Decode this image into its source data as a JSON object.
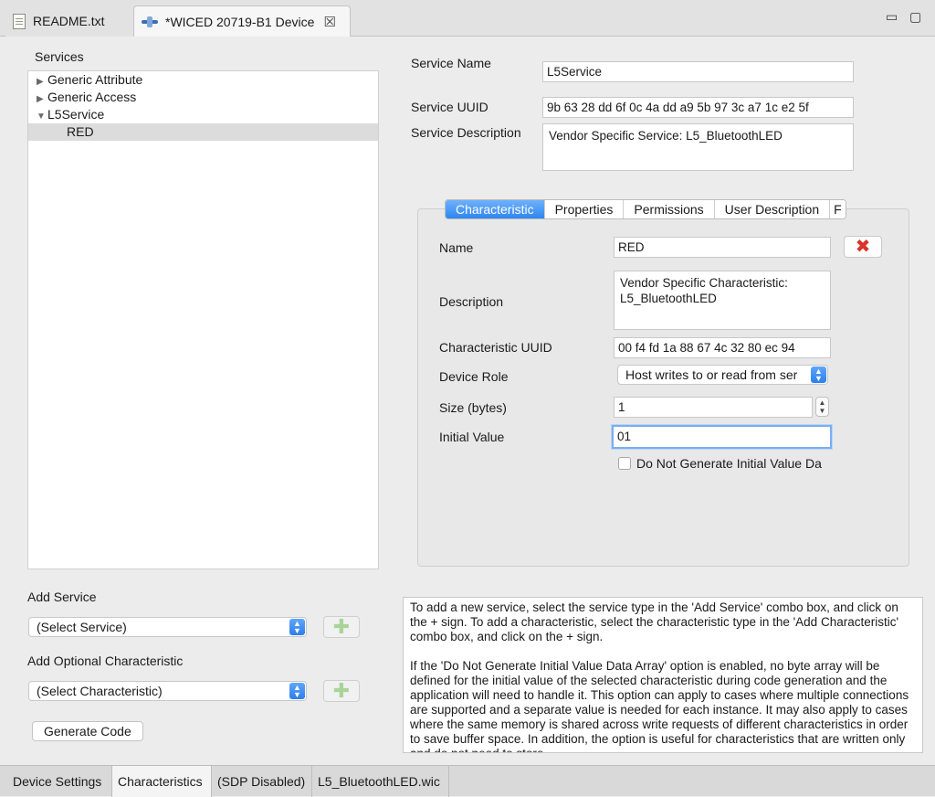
{
  "editor_tabs": [
    {
      "label": "README.txt",
      "active": false,
      "icon": "text-file-icon"
    },
    {
      "label": "*WICED 20719-B1 Device",
      "active": true,
      "icon": "device-configurator-icon",
      "close": "☒"
    }
  ],
  "window_controls": {
    "minimize": "▭",
    "maximize": "▢"
  },
  "services": {
    "heading": "Services",
    "tree": [
      {
        "label": "Generic Attribute",
        "expanded": false,
        "level": 0
      },
      {
        "label": "Generic Access",
        "expanded": false,
        "level": 0
      },
      {
        "label": "L5Service",
        "expanded": true,
        "level": 0
      },
      {
        "label": "RED",
        "level": 1,
        "selected": true
      }
    ]
  },
  "service_form": {
    "name_label": "Service Name",
    "name_value": "L5Service",
    "uuid_label": "Service UUID",
    "uuid_value": "9b 63 28 dd 6f 0c 4a dd a9 5b 97 3c a7 1c e2 5f",
    "desc_label": "Service Description",
    "desc_value": "Vendor Specific Service: L5_BluetoothLED"
  },
  "char_tabs": [
    {
      "label": "Characteristic",
      "active": true
    },
    {
      "label": "Properties"
    },
    {
      "label": "Permissions"
    },
    {
      "label": "User Description"
    },
    {
      "label": "F"
    }
  ],
  "characteristic": {
    "name_label": "Name",
    "name_value": "RED",
    "desc_label": "Description",
    "desc_value": "Vendor Specific Characteristic: L5_BluetoothLED",
    "uuid_label": "Characteristic UUID",
    "uuid_value": "00 f4 fd 1a 88 67 4c 32 80 ec 94",
    "role_label": "Device Role",
    "role_value": "Host writes to or read from ser",
    "size_label": "Size (bytes)",
    "size_value": "1",
    "init_label": "Initial Value",
    "init_value": "01",
    "no_init_label": "Do Not Generate Initial Value Da",
    "no_init_checked": false
  },
  "add_service": {
    "label": "Add Service",
    "selected": "(Select Service)"
  },
  "add_characteristic": {
    "label": "Add Optional Characteristic",
    "selected": "(Select Characteristic)"
  },
  "generate_button": "Generate Code",
  "help": {
    "para1": "To add a new service, select the service type in the 'Add Service' combo box, and click on the + sign. To add a characteristic, select the characteristic type in the 'Add Characteristic' combo box, and click on the + sign.",
    "para2": "If the 'Do Not Generate Initial Value Data Array' option is enabled, no byte array will be defined for the initial value of the selected characteristic during code generation and the application will need to handle it. This option can apply to cases where multiple connections are supported and a separate value is needed for each instance. It may also apply to cases where the same memory is shared across write requests of different characteristics in order to save buffer space. In addition, the option is useful for characteristics that are written only and do not need to store"
  },
  "bottom_tabs": [
    {
      "label": "Device Settings",
      "active": false
    },
    {
      "label": "Characteristics",
      "active": true
    },
    {
      "label": "(SDP Disabled)",
      "active": false
    },
    {
      "label": "L5_BluetoothLED.wic",
      "active": false
    }
  ],
  "colors": {
    "accent": "#2f86f0",
    "delete": "#d9332b",
    "add": "#aad39a"
  }
}
